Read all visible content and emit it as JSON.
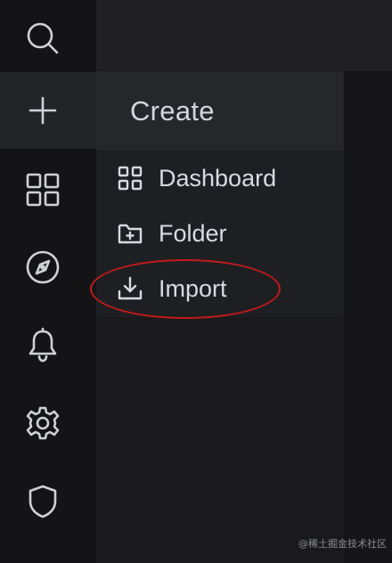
{
  "sidebar": {
    "items": [
      {
        "icon": "search-icon"
      },
      {
        "icon": "plus-icon",
        "active": true
      },
      {
        "icon": "dashboards-icon"
      },
      {
        "icon": "compass-icon"
      },
      {
        "icon": "bell-icon"
      },
      {
        "icon": "gear-icon"
      },
      {
        "icon": "shield-icon"
      }
    ]
  },
  "flyout": {
    "title": "Create",
    "items": [
      {
        "label": "Dashboard",
        "icon": "dashboard-grid-icon"
      },
      {
        "label": "Folder",
        "icon": "folder-plus-icon"
      },
      {
        "label": "Import",
        "icon": "import-icon",
        "highlighted": true
      }
    ]
  },
  "colors": {
    "sidebar_bg": "#141416",
    "flyout_bg": "#1e1f23",
    "header_bg": "#26272b",
    "text": "#d8dadf",
    "annotation_red": "#c21a1a"
  },
  "watermark": "@稀土掘金技术社区"
}
